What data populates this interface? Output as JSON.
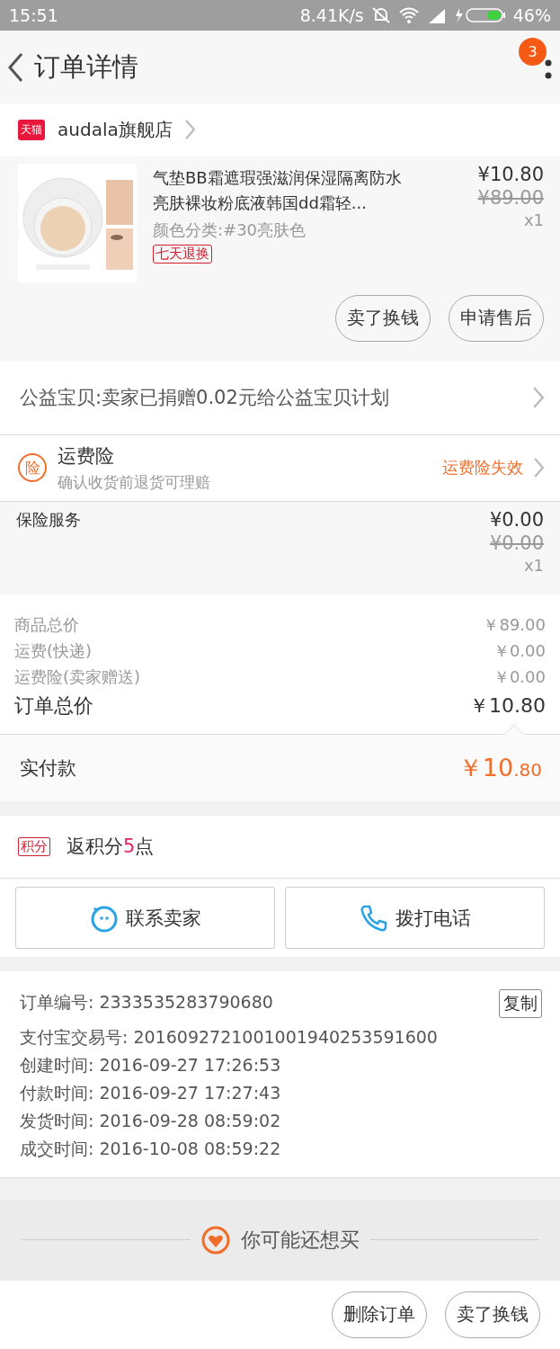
{
  "status_bar": {
    "time": "15:51",
    "speed": "8.41K/s",
    "battery": "46%"
  },
  "header": {
    "title": "订单详情",
    "badge": "3"
  },
  "shop": {
    "badge": "天猫",
    "name": "audala旗舰店"
  },
  "product": {
    "image": {
      "kind": "picture"
    },
    "title": "气垫BB霜遮瑕强滋润保湿隔离防水亮肤裸妆粉底液韩国dd霜轻...",
    "sku": "颜色分类:#30亮肤色",
    "tag": "七天退换",
    "price": "¥10.80",
    "original_price": "¥89.00",
    "quantity": "x1",
    "actions": [
      "卖了换钱",
      "申请售后"
    ]
  },
  "charity": {
    "text": "公益宝贝:卖家已捐赠0.02元给公益宝贝计划"
  },
  "insurance": {
    "icon": "险",
    "title": "运费险",
    "subtitle": "确认收货前退货可理赔",
    "status": "运费险失效"
  },
  "service": {
    "name": "保险服务",
    "price": "¥0.00",
    "original_price": "¥0.00",
    "quantity": "x1"
  },
  "totals": {
    "rows": [
      {
        "label": "商品总价",
        "value": "￥89.00"
      },
      {
        "label": "运费(快递)",
        "value": "￥0.00"
      },
      {
        "label": "运费险(卖家赠送)",
        "value": "￥0.00"
      }
    ],
    "total": {
      "label": "订单总价",
      "value": "￥10.80"
    }
  },
  "paid": {
    "label": "实付款",
    "amount": "￥10",
    "cents": ".80"
  },
  "points": {
    "tag": "积分",
    "prefix": "返积分",
    "count": "5",
    "suffix": "点"
  },
  "contact": [
    {
      "kind": "chat",
      "label": "联系卖家"
    },
    {
      "kind": "phone",
      "label": "拨打电话"
    }
  ],
  "order_info": {
    "copy": "复制",
    "rows": [
      "订单编号: 2333535283790680",
      "支付宝交易号: 2016092721001001940253591600",
      "创建时间: 2016-09-27 17:26:53",
      "付款时间: 2016-09-27 17:27:43",
      "发货时间: 2016-09-28 08:59:02",
      "成交时间: 2016-10-08 08:59:22"
    ]
  },
  "recommend": {
    "title": "你可能还想买"
  },
  "footer": {
    "buttons": [
      "删除订单",
      "卖了换钱"
    ]
  }
}
